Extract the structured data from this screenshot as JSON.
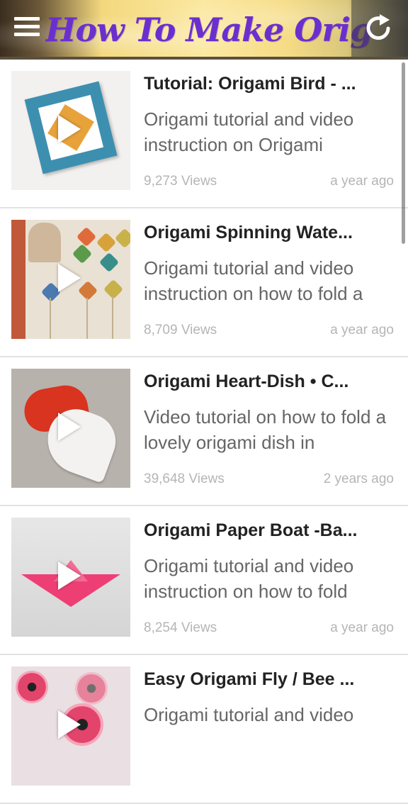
{
  "header": {
    "title": "How To Make Origami",
    "menu_icon": "hamburger-menu-icon",
    "refresh_icon": "refresh-icon"
  },
  "videos": [
    {
      "title": "Tutorial: Origami Bird - ...",
      "description": "Origami tutorial and video instruction on Origami",
      "views": "9,273 Views",
      "age": "a year ago"
    },
    {
      "title": "Origami Spinning Wate...",
      "description": "Origami tutorial and video instruction on how to fold a",
      "views": "8,709 Views",
      "age": "a year ago"
    },
    {
      "title": "Origami Heart-Dish • C...",
      "description": "Video tutorial on how to fold a lovely origami dish in",
      "views": "39,648 Views",
      "age": "2 years ago"
    },
    {
      "title": "Origami Paper Boat -Ba...",
      "description": "Origami tutorial and video instruction on how to fold",
      "views": "8,254 Views",
      "age": "a year ago"
    },
    {
      "title": "Easy Origami Fly / Bee ...",
      "description": "Origami tutorial and video",
      "views": "",
      "age": ""
    }
  ],
  "colors": {
    "title_purple": "#6b2fcf",
    "list_title": "#222222",
    "list_desc": "#666666",
    "list_meta": "#b5b5b5",
    "divider": "#e2e2e2"
  }
}
